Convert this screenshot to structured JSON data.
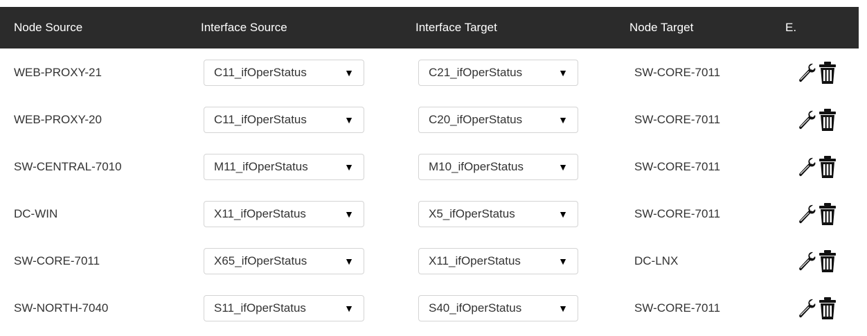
{
  "table": {
    "headers": {
      "node_source": "Node Source",
      "interface_source": "Interface Source",
      "interface_target": "Interface Target",
      "node_target": "Node Target",
      "edit": "E."
    },
    "rows": [
      {
        "node_source": "WEB-PROXY-21",
        "interface_source": "C11_ifOperStatus",
        "interface_target": "C21_ifOperStatus",
        "node_target": "SW-CORE-7011"
      },
      {
        "node_source": "WEB-PROXY-20",
        "interface_source": "C11_ifOperStatus",
        "interface_target": "C20_ifOperStatus",
        "node_target": "SW-CORE-7011"
      },
      {
        "node_source": "SW-CENTRAL-7010",
        "interface_source": "M11_ifOperStatus",
        "interface_target": "M10_ifOperStatus",
        "node_target": "SW-CORE-7011"
      },
      {
        "node_source": "DC-WIN",
        "interface_source": "X11_ifOperStatus",
        "interface_target": "X5_ifOperStatus",
        "node_target": "SW-CORE-7011"
      },
      {
        "node_source": "SW-CORE-7011",
        "interface_source": "X65_ifOperStatus",
        "interface_target": "X11_ifOperStatus",
        "node_target": "DC-LNX"
      },
      {
        "node_source": "SW-NORTH-7040",
        "interface_source": "S11_ifOperStatus",
        "interface_target": "S40_ifOperStatus",
        "node_target": "SW-CORE-7011"
      }
    ],
    "caret": "▼",
    "icons": {
      "edit": "wrench-icon",
      "delete": "trash-icon"
    }
  },
  "colors": {
    "header_bg": "#2b2b2b",
    "header_text": "#ffffff",
    "cell_text": "#333333",
    "select_border": "#d4d4d4"
  }
}
